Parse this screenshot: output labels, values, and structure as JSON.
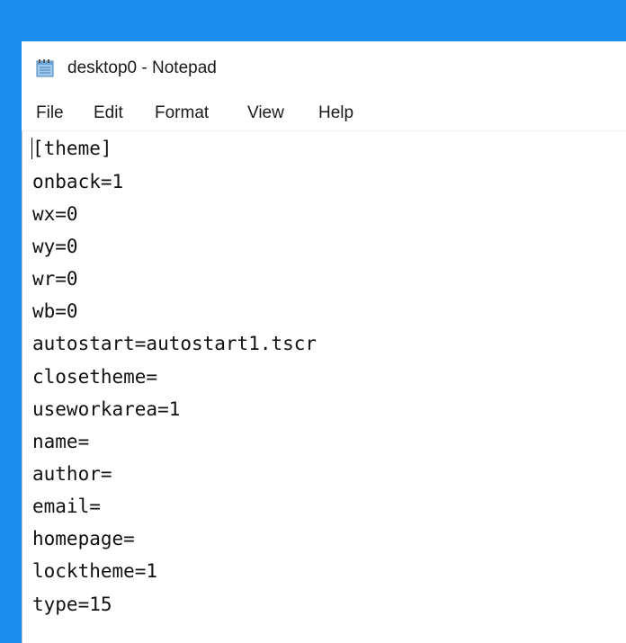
{
  "window": {
    "title": "desktop0 - Notepad",
    "title_icon": "notepad-icon"
  },
  "menu": {
    "file": "File",
    "edit": "Edit",
    "format": "Format",
    "view": "View",
    "help": "Help"
  },
  "editor": {
    "lines": [
      "[theme]",
      "onback=1",
      "wx=0",
      "wy=0",
      "wr=0",
      "wb=0",
      "autostart=autostart1.tscr",
      "closetheme=",
      "useworkarea=1",
      "name=",
      "author=",
      "email=",
      "homepage=",
      "locktheme=1",
      "type=15"
    ]
  },
  "colors": {
    "accent_border": "#1b8ef0",
    "text": "#111111",
    "background": "#ffffff"
  }
}
